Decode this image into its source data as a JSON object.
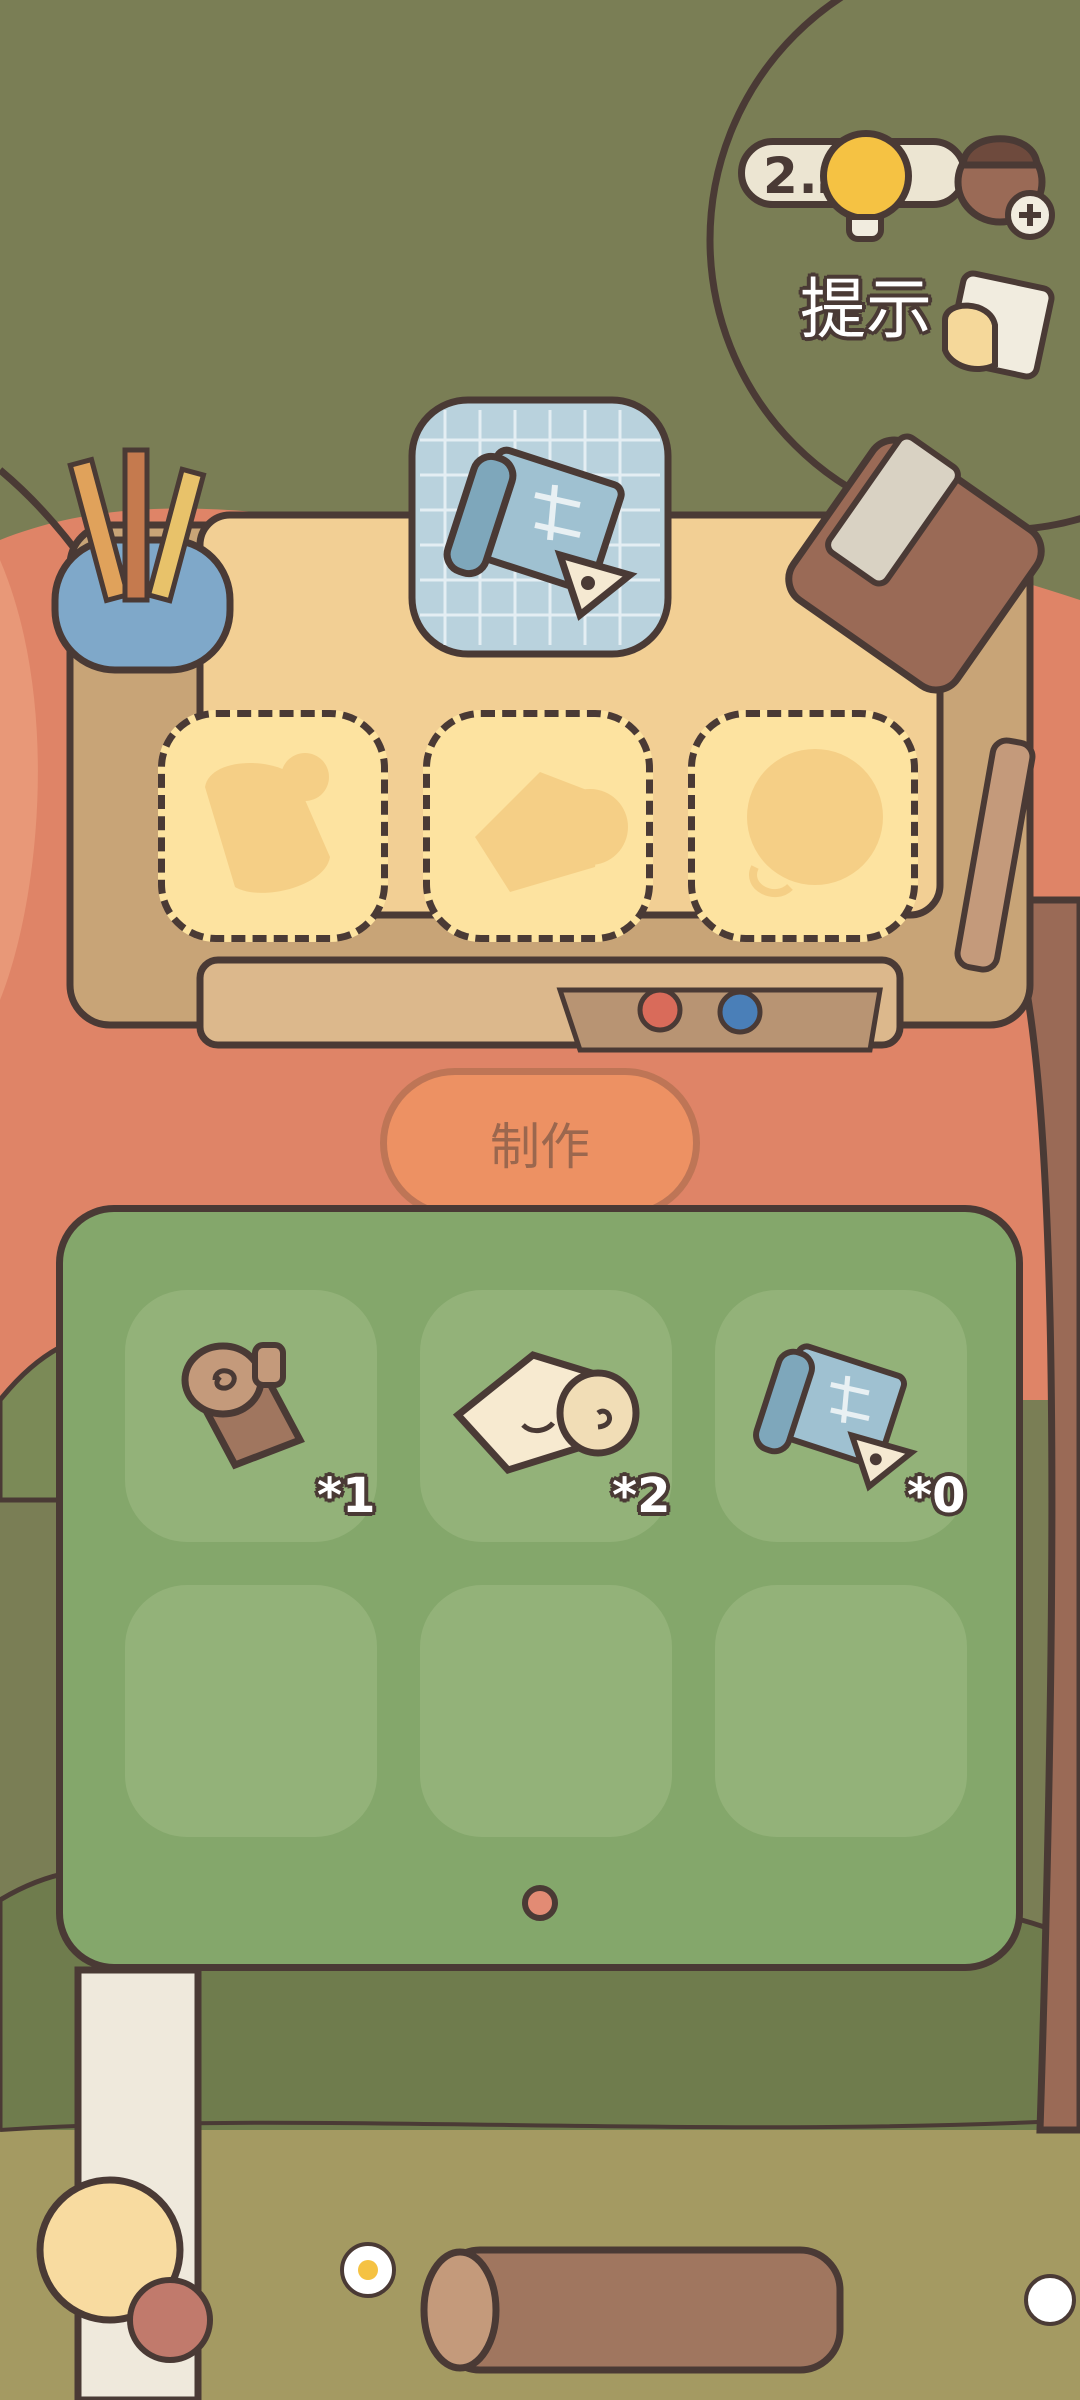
{
  "hint": {
    "counter": "2…2",
    "label": "提示"
  },
  "recipe": {
    "target_icon": "blueprint-scroll-icon",
    "slots": [
      {
        "ghost_icon": "wood-log-silhouette-icon"
      },
      {
        "ghost_icon": "cloth-roll-silhouette-icon"
      },
      {
        "ghost_icon": "blueprint-silhouette-icon"
      }
    ]
  },
  "make_button": {
    "label": "制作",
    "enabled": false
  },
  "inventory": {
    "items": [
      {
        "icon": "wood-log-icon",
        "count": "*1"
      },
      {
        "icon": "cloth-roll-icon",
        "count": "*2"
      },
      {
        "icon": "blueprint-scroll-icon",
        "count": "*0"
      }
    ],
    "page_indicator": "1"
  },
  "colors": {
    "forest": "#7a7e55",
    "sunset": "#df8467",
    "panel": "#84a76b",
    "table": "#f2cf94",
    "outline": "#4a3a35",
    "hint_bulb": "#f5c243"
  }
}
